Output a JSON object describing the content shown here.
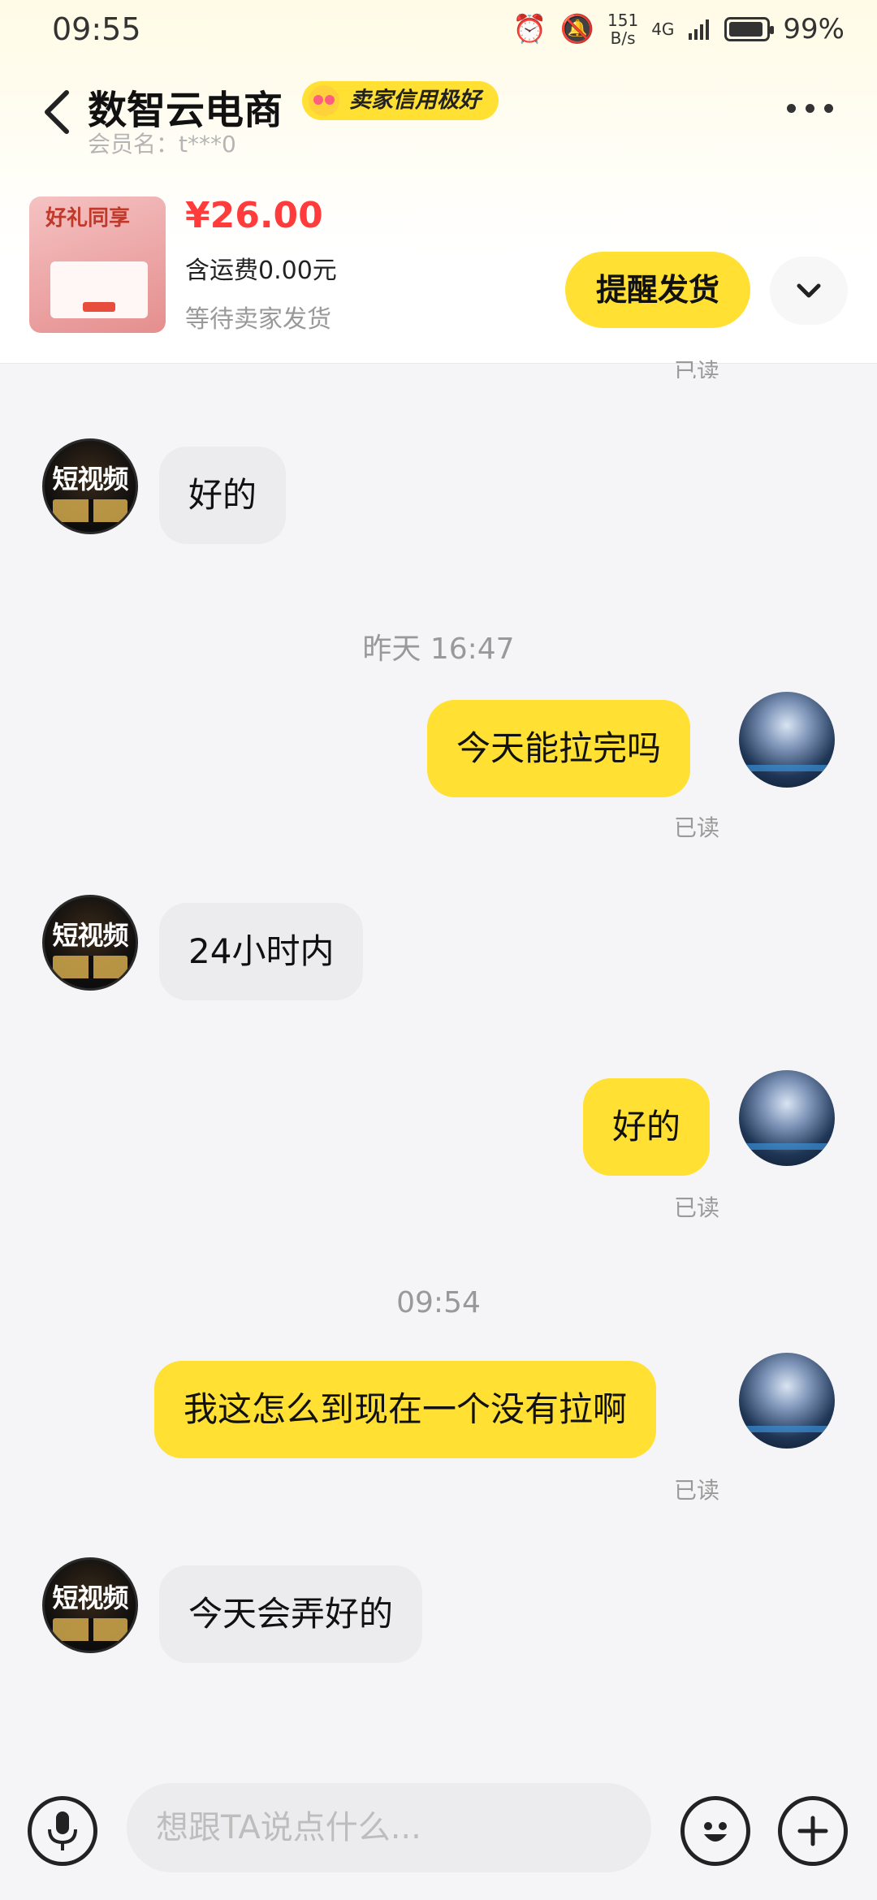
{
  "status_bar": {
    "time": "09:55",
    "net_speed_value": "151",
    "net_speed_unit": "B/s",
    "network": "4G",
    "battery": "99%"
  },
  "header": {
    "shop_name": "数智云电商",
    "credit_badge": "卖家信用极好",
    "member_label": "会员名：t***0"
  },
  "order": {
    "thumb_text_1": "好礼同享",
    "price": "¥26.00",
    "shipping": "含运费0.00元",
    "status": "等待卖家发货",
    "remind_label": "提醒发货"
  },
  "seller_avatar_text": "短视频",
  "messages": [
    {
      "side": "read",
      "text": "已读"
    },
    {
      "side": "left",
      "text": "好的"
    },
    {
      "side": "time",
      "text": "昨天 16:47"
    },
    {
      "side": "right",
      "text": "今天能拉完吗"
    },
    {
      "side": "read",
      "text": "已读"
    },
    {
      "side": "left",
      "text": "24小时内"
    },
    {
      "side": "right",
      "text": "好的"
    },
    {
      "side": "read",
      "text": "已读"
    },
    {
      "side": "time",
      "text": "09:54"
    },
    {
      "side": "right",
      "text": "我这怎么到现在一个没有拉啊"
    },
    {
      "side": "read",
      "text": "已读"
    },
    {
      "side": "left",
      "text": "今天会弄好的"
    }
  ],
  "input": {
    "placeholder": "想跟TA说点什么..."
  },
  "colors": {
    "accent_yellow": "#ffe033",
    "price_red": "#ff3b3b"
  }
}
